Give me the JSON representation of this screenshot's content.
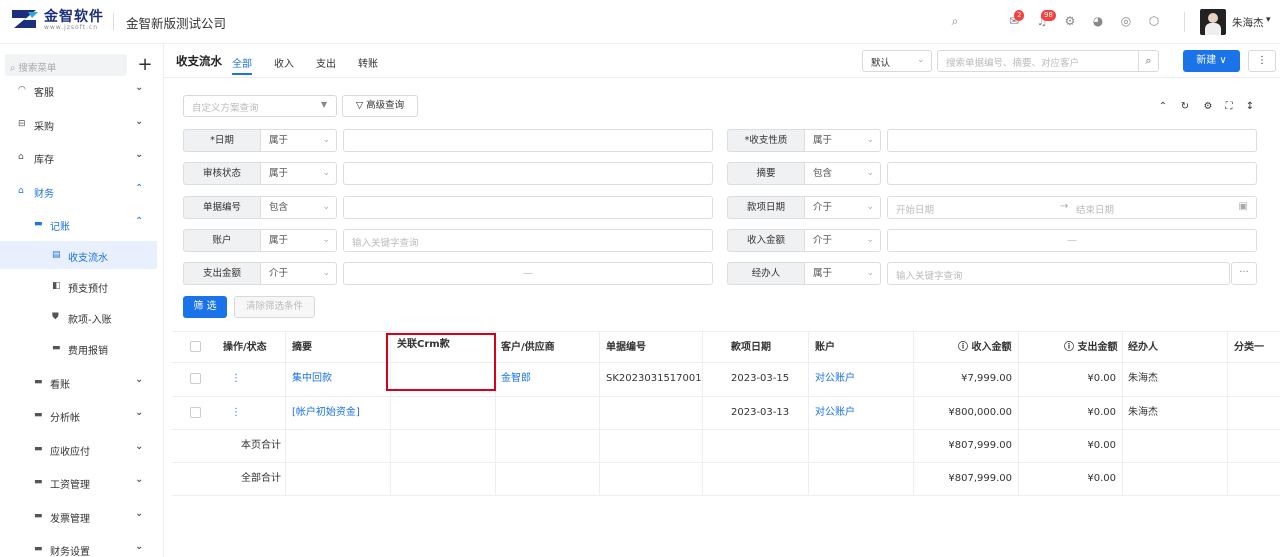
{
  "app": {
    "logo_text": "金智软件",
    "logo_sub": "www.jzsoft.cn",
    "company": "金智新版测试公司",
    "user": "朱海杰"
  },
  "header_icons": [
    {
      "name": "search-icon",
      "glyph": "⌕"
    },
    {
      "name": "message-icon",
      "glyph": "✉",
      "badge": "2"
    },
    {
      "name": "bell-icon",
      "glyph": "🔔",
      "badge": "98"
    },
    {
      "name": "settings-icon",
      "glyph": "⚙"
    },
    {
      "name": "pie-chart-icon",
      "glyph": "◕"
    },
    {
      "name": "globe-icon",
      "glyph": "◎"
    },
    {
      "name": "box-icon",
      "glyph": "⬡"
    }
  ],
  "sidebar": {
    "search_placeholder": "搜索菜单",
    "items": [
      {
        "label": "客服"
      },
      {
        "label": "采购"
      },
      {
        "label": "库存"
      },
      {
        "label": "财务"
      },
      {
        "label": "记账"
      },
      {
        "label": "收支流水"
      },
      {
        "label": "预支预付"
      },
      {
        "label": "款项-入账"
      },
      {
        "label": "费用报销"
      },
      {
        "label": "看账"
      },
      {
        "label": "分析帐"
      },
      {
        "label": "应收应付"
      },
      {
        "label": "工资管理"
      },
      {
        "label": "发票管理"
      },
      {
        "label": "财务设置"
      }
    ]
  },
  "page": {
    "title": "收支流水",
    "tabs": [
      "全部",
      "收入",
      "支出",
      "转账"
    ],
    "view_select": "默认",
    "search_placeholder": "搜索单据编号、摘要、对应客户",
    "new_button": "新建",
    "more_button": "⋮"
  },
  "filters": {
    "scheme_placeholder": "自定义方案查询",
    "advanced": "高级查询",
    "rows": [
      {
        "label": "*日期",
        "op": "属于",
        "value": ""
      },
      {
        "label": "*收支性质",
        "op": "属于",
        "value": ""
      },
      {
        "label": "审核状态",
        "op": "属于",
        "value": ""
      },
      {
        "label": "摘要",
        "op": "包含",
        "value": ""
      },
      {
        "label": "单据编号",
        "op": "包含",
        "value": ""
      },
      {
        "label": "款项日期",
        "op": "介于",
        "start": "开始日期",
        "end": "结束日期"
      },
      {
        "label": "账户",
        "op": "属于",
        "placeholder": "输入关键字查询"
      },
      {
        "label": "收入金额",
        "op": "介于",
        "dash": "—"
      },
      {
        "label": "支出金额",
        "op": "介于",
        "dash": "—"
      },
      {
        "label": "经办人",
        "op": "属于",
        "placeholder": "输入关键字查询",
        "more": "···"
      }
    ],
    "apply": "筛 选",
    "clear": "清除筛选条件"
  },
  "table": {
    "headers": [
      "操作/状态",
      "摘要",
      "关联Crm款",
      "客户/供应商",
      "单据编号",
      "款项日期",
      "账户",
      "收入金额",
      "支出金额",
      "经办人",
      "分类一"
    ],
    "rows": [
      {
        "action": "⋮",
        "summary": "集中回款",
        "crm": "",
        "customer": "金智郎",
        "doc_no": "SK2023031517001",
        "date": "2023-03-15",
        "account": "对公账户",
        "income": "¥7,999.00",
        "expense": "¥0.00",
        "handler": "朱海杰"
      },
      {
        "action": "⋮",
        "summary": "[帐户初始资金]",
        "crm": "",
        "customer": "",
        "doc_no": "",
        "date": "2023-03-13",
        "account": "对公账户",
        "income": "¥800,000.00",
        "expense": "¥0.00",
        "handler": "朱海杰"
      }
    ],
    "page_total": {
      "label": "本页合计",
      "income": "¥807,999.00",
      "expense": "¥0.00"
    },
    "all_total": {
      "label": "全部合计",
      "income": "¥807,999.00",
      "expense": "¥0.00"
    }
  },
  "colors": {
    "accent": "#1a73e8",
    "highlight": "#d9001b"
  }
}
